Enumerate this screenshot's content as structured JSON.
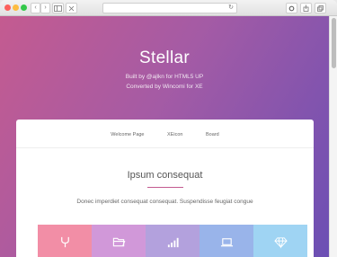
{
  "browser": {
    "reload_glyph": "↻",
    "back_glyph": "‹",
    "forward_glyph": "›"
  },
  "hero": {
    "title": "Stellar",
    "subtitle_line1": "Built by @ajlkn for HTML5 UP",
    "subtitle_line2": "Converted by Wincomi for XE"
  },
  "nav": {
    "items": [
      "Welcome Page",
      "XEicon",
      "Board"
    ]
  },
  "section": {
    "title": "Ipsum consequat",
    "description": "Donec imperdiet consequat consequat. Suspendisse feugiat congue"
  },
  "tiles": [
    {
      "icon": "fork-icon",
      "color": "#f28ea6"
    },
    {
      "icon": "folder-icon",
      "color": "#d198d9"
    },
    {
      "icon": "signal-bars-icon",
      "color": "#b3a1dd"
    },
    {
      "icon": "laptop-icon",
      "color": "#99b4ea"
    },
    {
      "icon": "diamond-icon",
      "color": "#9fd4f3"
    }
  ],
  "colors": {
    "gradient_start": "#c45b90",
    "gradient_end": "#6b4fb4"
  }
}
